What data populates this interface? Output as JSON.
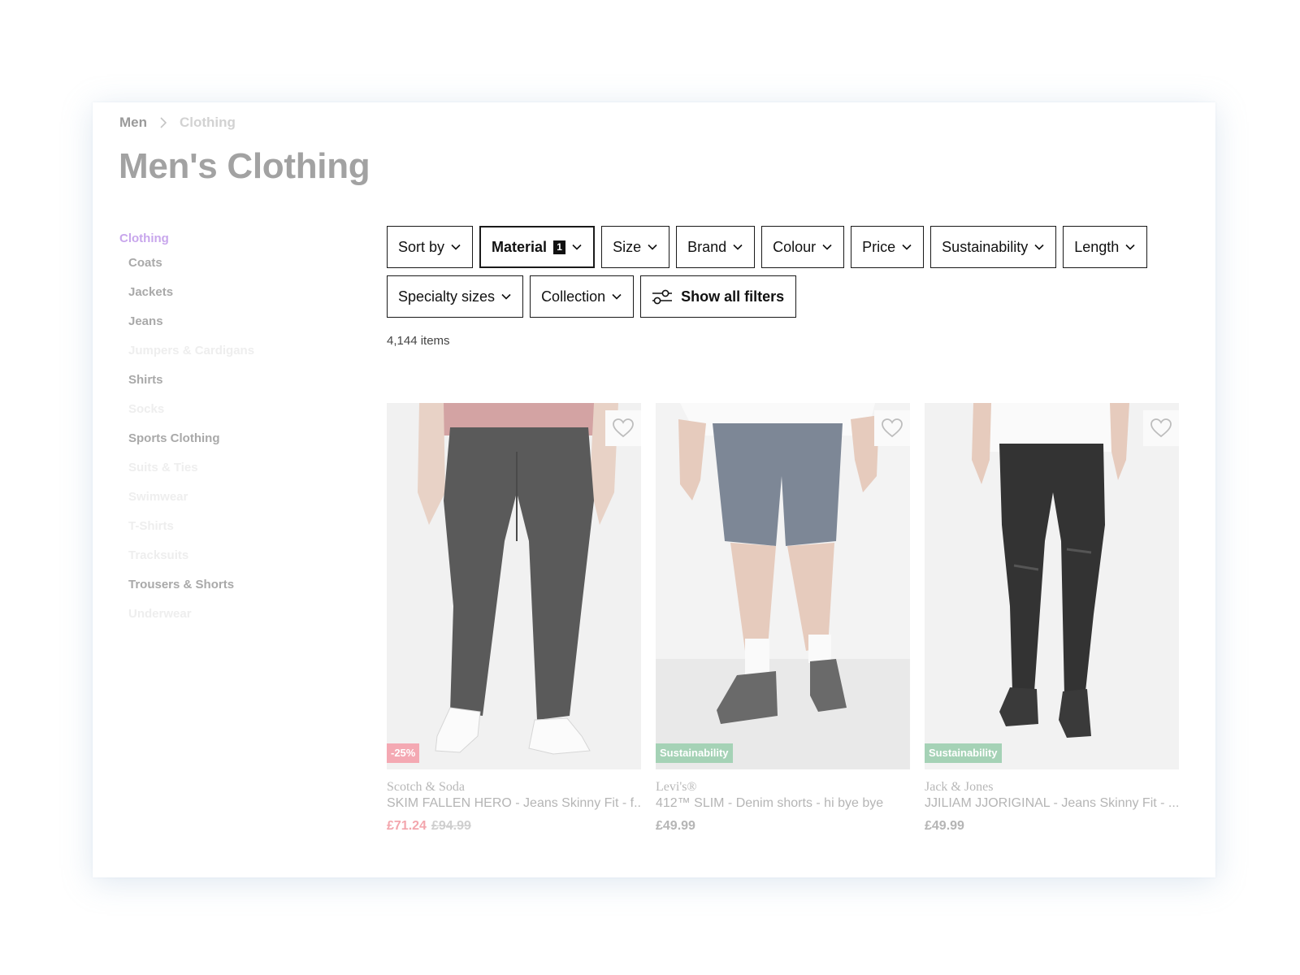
{
  "breadcrumb": {
    "items": [
      "Men",
      "Clothing"
    ]
  },
  "page": {
    "title": "Men's Clothing",
    "item_count": "4,144 items"
  },
  "sidebar": {
    "heading": "Clothing",
    "items": [
      {
        "label": "Coats",
        "faded": false
      },
      {
        "label": "Jackets",
        "faded": false
      },
      {
        "label": "Jeans",
        "faded": false
      },
      {
        "label": "Jumpers & Cardigans",
        "faded": true
      },
      {
        "label": "Shirts",
        "faded": false
      },
      {
        "label": "Socks",
        "faded": true
      },
      {
        "label": "Sports Clothing",
        "faded": false
      },
      {
        "label": "Suits & Ties",
        "faded": true
      },
      {
        "label": "Swimwear",
        "faded": true
      },
      {
        "label": "T-Shirts",
        "faded": true
      },
      {
        "label": "Tracksuits",
        "faded": true
      },
      {
        "label": "Trousers & Shorts",
        "faded": false
      },
      {
        "label": "Underwear",
        "faded": true
      }
    ]
  },
  "filters": {
    "row1": [
      "Sort by",
      "Material",
      "Size",
      "Brand",
      "Colour",
      "Price",
      "Sustainability",
      "Length"
    ],
    "row2": [
      "Specialty sizes",
      "Collection"
    ],
    "material_count": "1",
    "show_all_label": "Show all filters"
  },
  "products": [
    {
      "brand": "Scotch & Soda",
      "name": "SKIM FALLEN HERO - Jeans Skinny Fit - f...",
      "price": "£71.24",
      "original_price": "£94.99",
      "badge": "-25%",
      "badge_type": "sale"
    },
    {
      "brand": "Levi's®",
      "name": "412™ SLIM - Denim shorts - hi bye bye",
      "price": "£49.99",
      "original_price": "",
      "badge": "Sustainability",
      "badge_type": "eco"
    },
    {
      "brand": "Jack & Jones",
      "name": "JJILIAM JJORIGINAL - Jeans Skinny Fit - ...",
      "price": "£49.99",
      "original_price": "",
      "badge": "Sustainability",
      "badge_type": "eco"
    }
  ],
  "colors": {
    "accent": "#c8a6ec",
    "sale": "#f4a9b3",
    "sustainability": "#a5d2b6"
  }
}
